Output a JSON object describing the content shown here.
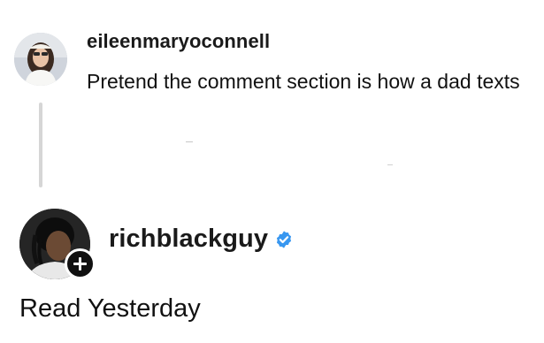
{
  "first_comment": {
    "username": "eileenmaryoconnell",
    "text": "Pretend the comment section is how a dad texts",
    "avatar_icon": "profile-photo"
  },
  "author": {
    "username": "richblackguy",
    "verified": true,
    "verified_color": "#3897f0",
    "avatar_icon": "profile-photo",
    "follow_icon": "plus-icon"
  },
  "post": {
    "text": "Read Yesterday"
  }
}
